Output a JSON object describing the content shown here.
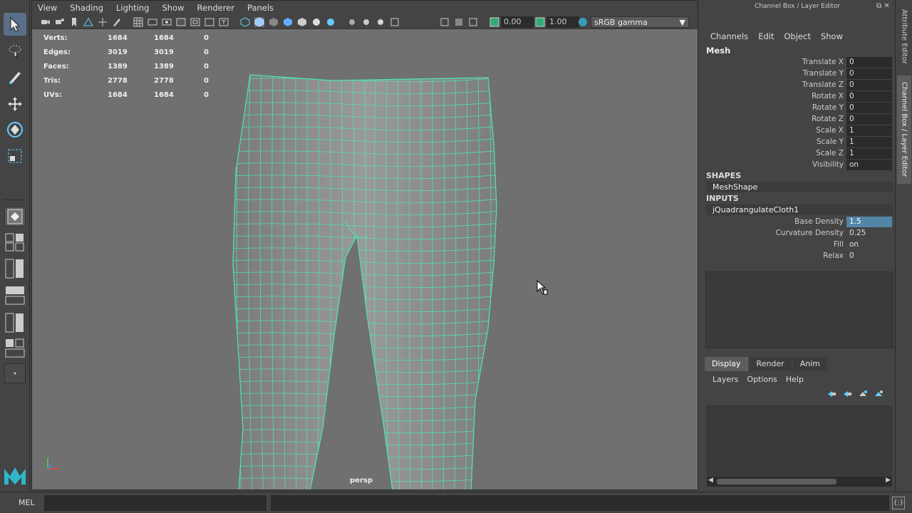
{
  "viewport": {
    "menu": [
      "View",
      "Shading",
      "Lighting",
      "Show",
      "Renderer",
      "Panels"
    ],
    "exposure": "0.00",
    "gamma": "1.00",
    "color_space": "sRGB gamma",
    "camera": "persp",
    "hud": [
      {
        "label": "Verts:",
        "a": "1684",
        "b": "1684",
        "c": "0"
      },
      {
        "label": "Edges:",
        "a": "3019",
        "b": "3019",
        "c": "0"
      },
      {
        "label": "Faces:",
        "a": "1389",
        "b": "1389",
        "c": "0"
      },
      {
        "label": "Tris:",
        "a": "2778",
        "b": "2778",
        "c": "0"
      },
      {
        "label": "UVs:",
        "a": "1684",
        "b": "1684",
        "c": "0"
      }
    ]
  },
  "right_panel": {
    "title": "Channel Box / Layer Editor",
    "menu": [
      "Channels",
      "Edit",
      "Object",
      "Show"
    ],
    "object": "Mesh",
    "channels": [
      {
        "name": "Translate X",
        "value": "0"
      },
      {
        "name": "Translate Y",
        "value": "0"
      },
      {
        "name": "Translate Z",
        "value": "0"
      },
      {
        "name": "Rotate X",
        "value": "0"
      },
      {
        "name": "Rotate Y",
        "value": "0"
      },
      {
        "name": "Rotate Z",
        "value": "0"
      },
      {
        "name": "Scale X",
        "value": "1"
      },
      {
        "name": "Scale Y",
        "value": "1"
      },
      {
        "name": "Scale Z",
        "value": "1"
      },
      {
        "name": "Visibility",
        "value": "on"
      }
    ],
    "shapes_header": "SHAPES",
    "shape": "MeshShape",
    "inputs_header": "INPUTS",
    "input_node": "jQuadrangulateCloth1",
    "input_attrs": [
      {
        "name": "Base Density",
        "value": "1.5"
      },
      {
        "name": "Curvature Density",
        "value": "0.25"
      },
      {
        "name": "Fill",
        "value": "on"
      },
      {
        "name": "Relax",
        "value": "0"
      }
    ],
    "tabs": [
      "Display",
      "Render",
      "Anim"
    ],
    "layer_menu": [
      "Layers",
      "Options",
      "Help"
    ]
  },
  "side_tabs": [
    "Attribute Editor",
    "Channel Box / Layer Editor"
  ],
  "bottom": {
    "mel": "MEL"
  },
  "colors": {
    "wire": "#4de8b0",
    "highlight": "#5285a6"
  }
}
